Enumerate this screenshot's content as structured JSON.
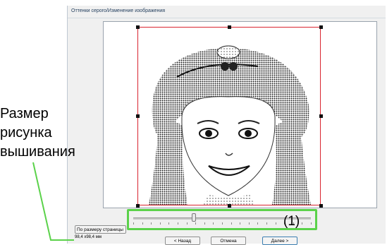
{
  "window": {
    "title": "Оттенки серого/Изменение изображения"
  },
  "preview": {
    "image_label": "grayscale-photo-girl-portrait"
  },
  "slider": {
    "value_fraction": 0.34,
    "tick_count": 21
  },
  "buttons": {
    "fit_to_page": "По размеру страницы",
    "back": "< Назад",
    "cancel": "Отмена",
    "next": "Далее >"
  },
  "status": {
    "embroidery_size": "98,4 x98,4 мм"
  },
  "annotations": {
    "slider_callout": "(1)",
    "size_callout_lines": [
      "Размер",
      "рисунка",
      "вышивания"
    ]
  },
  "colors": {
    "callout_green": "#5bd24a",
    "frame_red": "#d9242f"
  }
}
